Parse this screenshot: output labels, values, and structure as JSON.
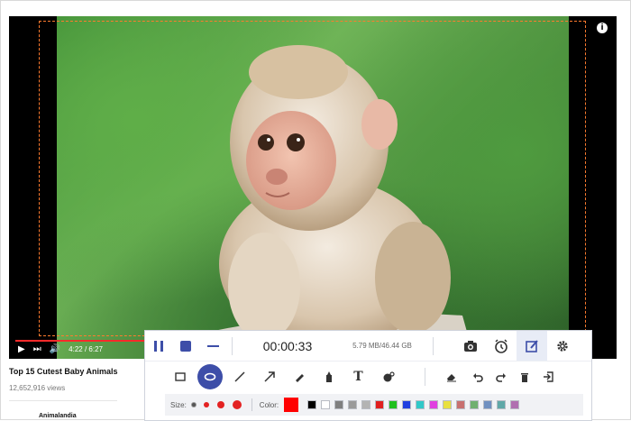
{
  "player": {
    "info_icon": "info-icon",
    "time_display": "4:22 / 6:27",
    "progress": 0.677
  },
  "video": {
    "title": "Top 15 Cutest Baby Animals",
    "views": "12,652,916 views",
    "channel": "Animalandia"
  },
  "recorder": {
    "timer": "00:00:33",
    "file_size": "5.79 MB/46.44 GB",
    "size_label": "Size:",
    "color_label": "Color:",
    "current_color": "#ff0000",
    "top_tools": [
      "camera-icon",
      "alarm-clock-icon",
      "edit-icon",
      "gear-icon"
    ],
    "draw_tools": [
      "rectangle-icon",
      "ellipse-icon",
      "line-icon",
      "arrow-icon",
      "pen-icon",
      "highlighter-icon",
      "text-icon",
      "callout-icon"
    ],
    "action_tools": [
      "eraser-icon",
      "undo-icon",
      "redo-icon",
      "trash-icon",
      "exit-icon"
    ],
    "palette": [
      "#000000",
      "#ffffff",
      "#7f7f7f",
      "#9a9a9a",
      "#b3b3b3",
      "#e02020",
      "#1fbf1f",
      "#1f3fe0",
      "#30c8c8",
      "#e040e0",
      "#e8e040",
      "#c87070",
      "#70b070",
      "#7090c0",
      "#60a8a8",
      "#b070b0"
    ]
  }
}
